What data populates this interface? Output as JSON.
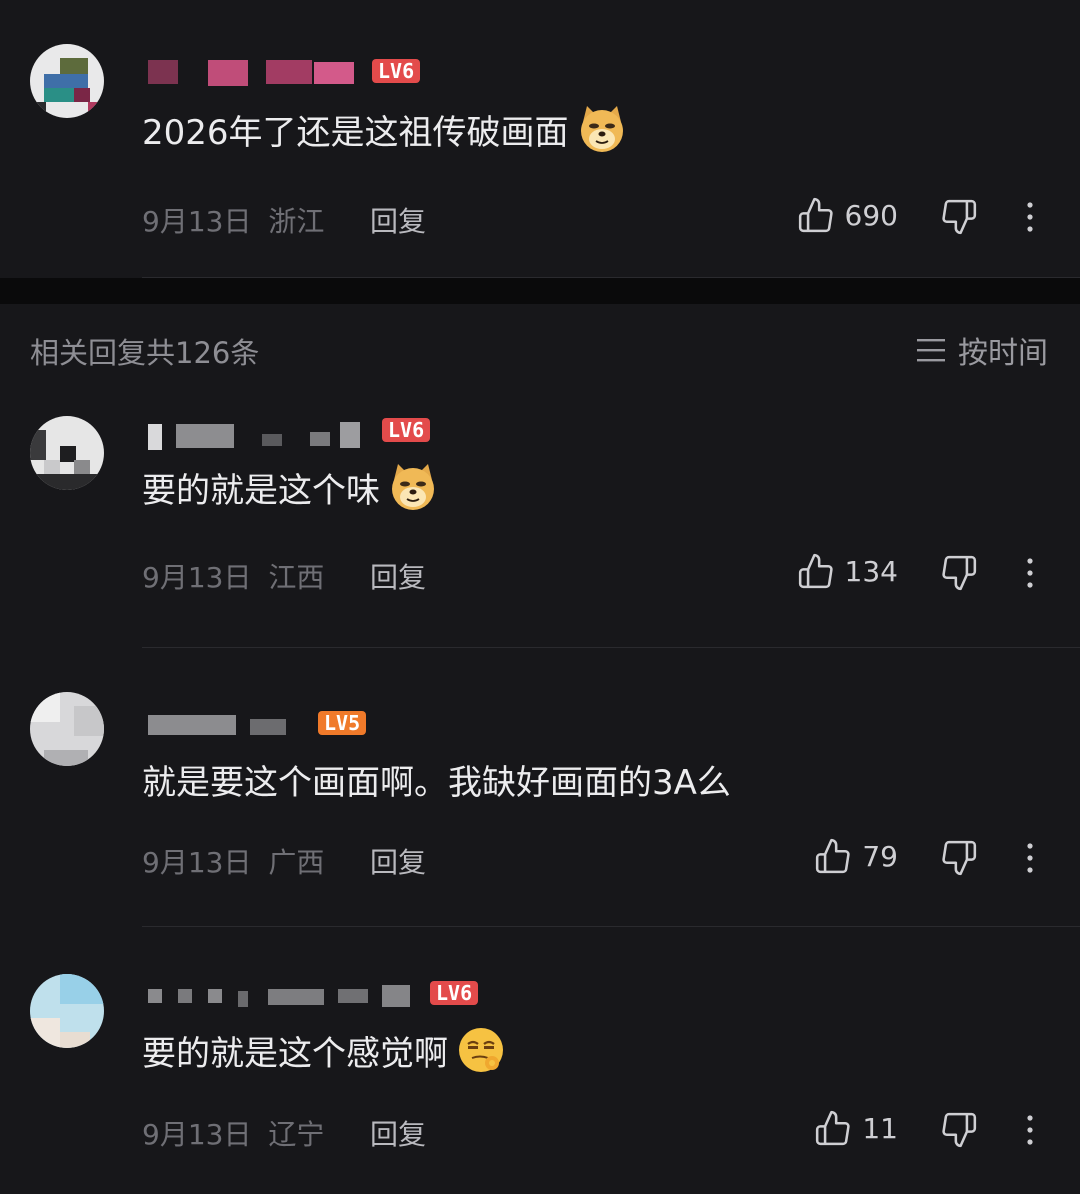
{
  "comments": [
    {
      "level": "LV6",
      "text": "2026年了还是这祖传破画面",
      "emoji": "doge-icon",
      "date": "9月13日",
      "region": "浙江",
      "reply_label": "回复",
      "likes": "690"
    },
    {
      "level": "LV6",
      "text": "要的就是这个味",
      "emoji": "doge-icon",
      "date": "9月13日",
      "region": "江西",
      "reply_label": "回复",
      "likes": "134"
    },
    {
      "level": "LV5",
      "text": "就是要这个画面啊。我缺好画面的3A么",
      "emoji": "",
      "date": "9月13日",
      "region": "广西",
      "reply_label": "回复",
      "likes": "79"
    },
    {
      "level": "LV6",
      "text": "要的就是这个感觉啊",
      "emoji": "smirk-emoji-icon",
      "date": "9月13日",
      "region": "辽宁",
      "reply_label": "回复",
      "likes": "11"
    }
  ],
  "replies_header": {
    "count_text": "相关回复共126条",
    "sort_label": "按时间",
    "sort_icon": "list-sort-icon"
  },
  "colors": {
    "background": "#17171a",
    "level6": "#e34b4b",
    "level5": "#f07a2a"
  }
}
